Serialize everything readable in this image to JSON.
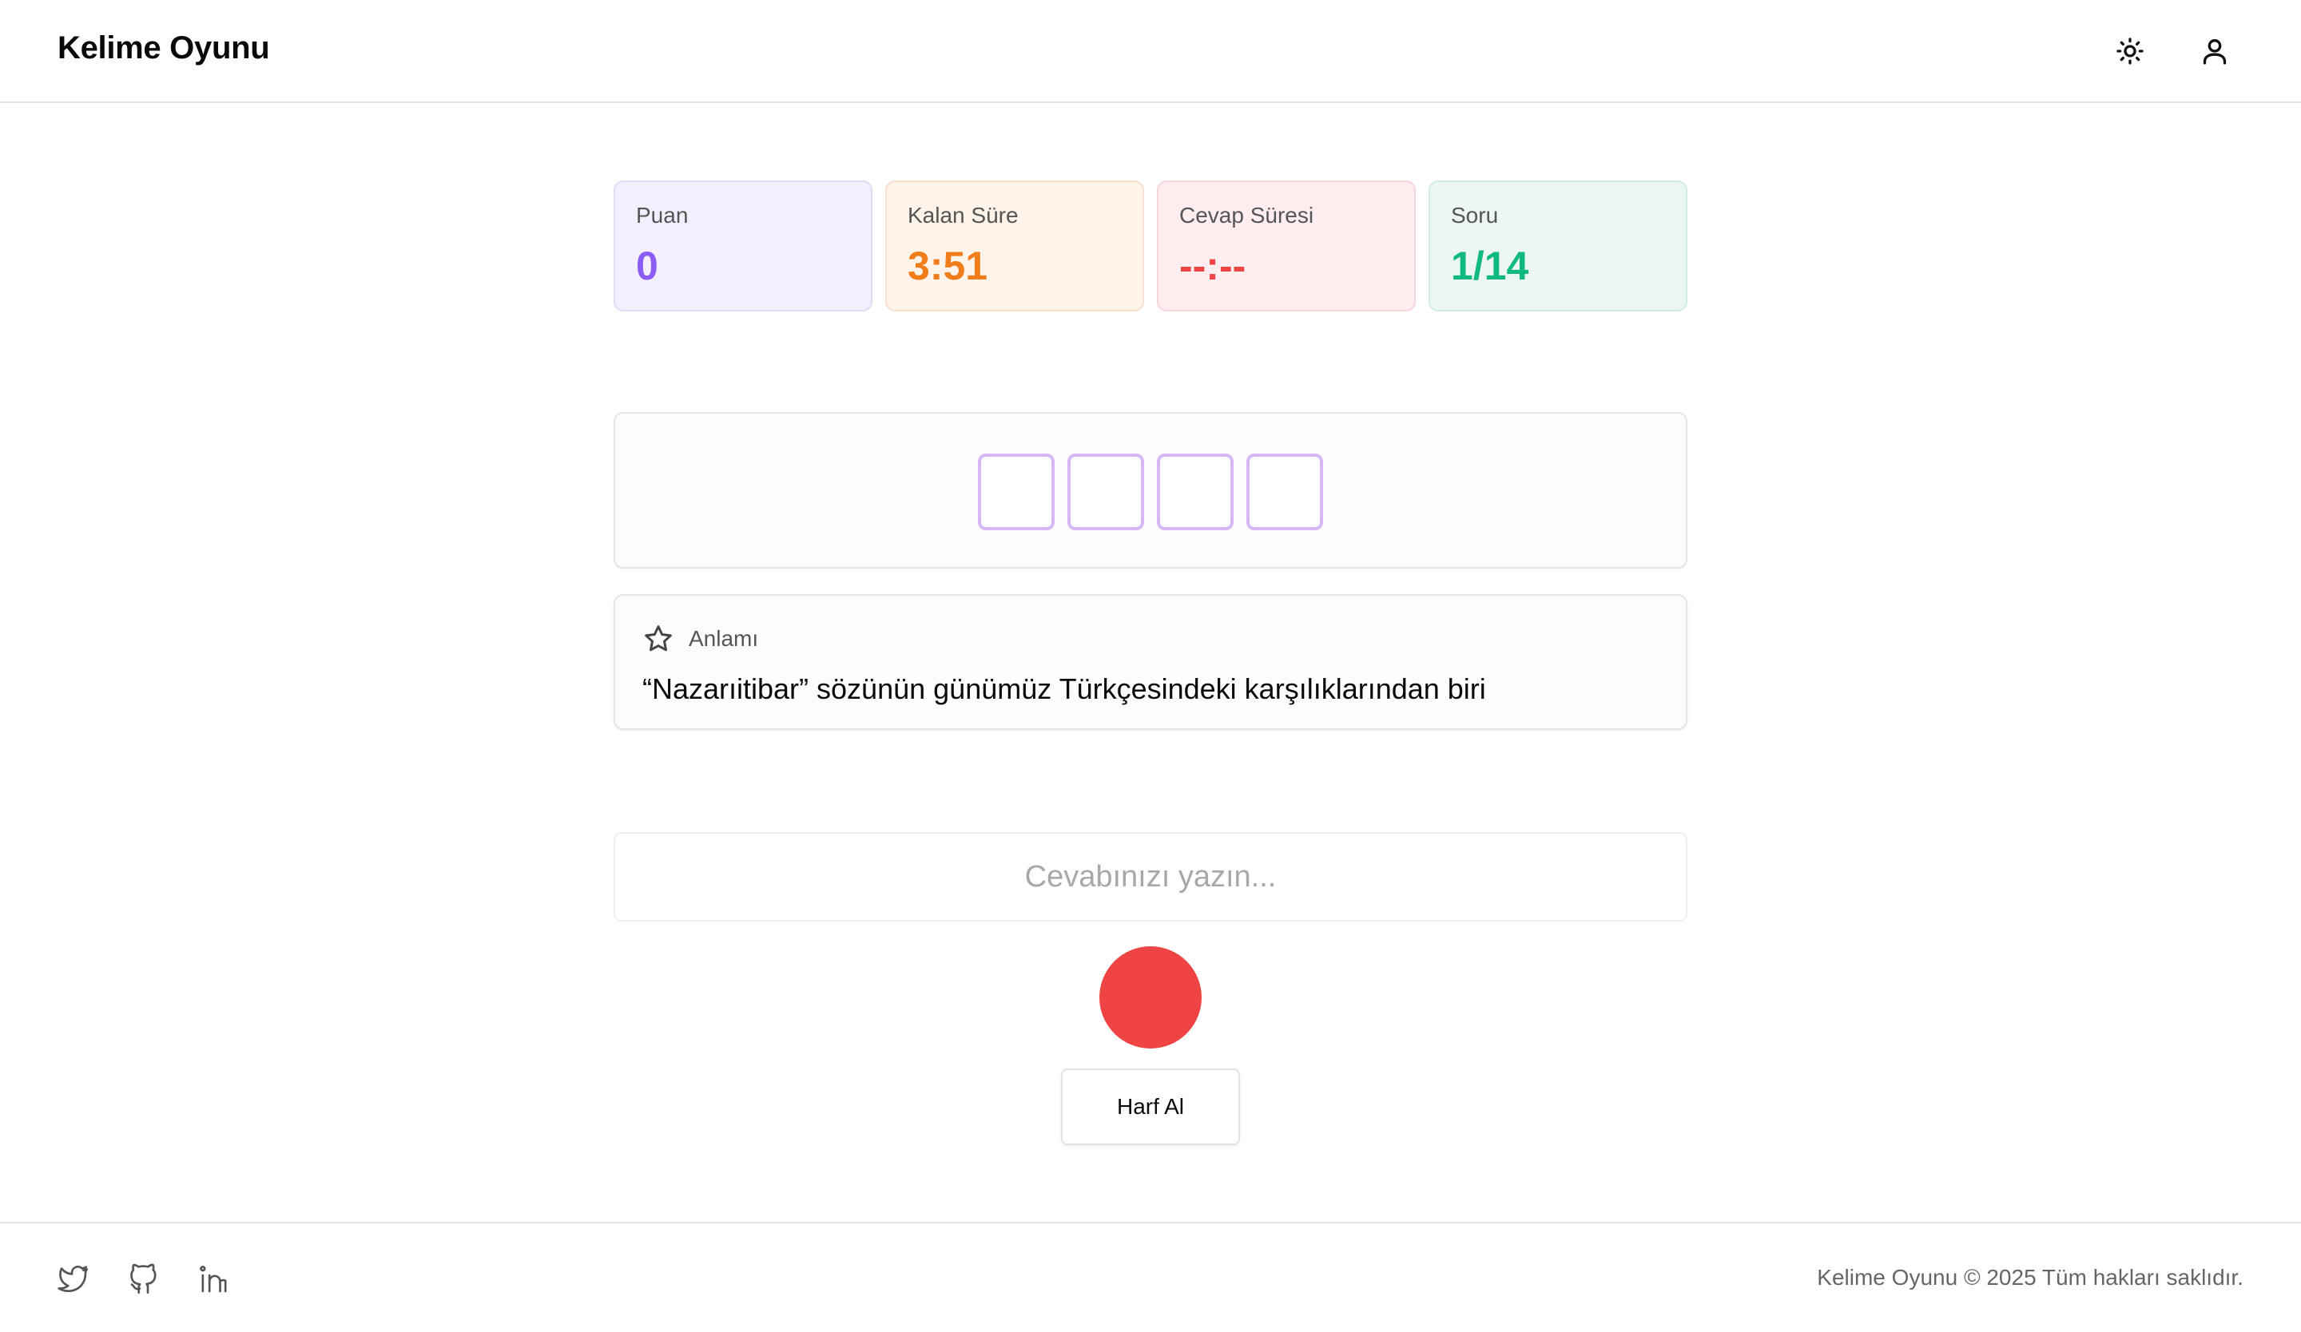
{
  "header": {
    "title": "Kelime Oyunu",
    "theme_icon": "sun-icon",
    "user_icon": "user-icon"
  },
  "stats": {
    "score": {
      "label": "Puan",
      "value": "0",
      "color": "#8b5cf6"
    },
    "time_left": {
      "label": "Kalan Süre",
      "value": "3:51",
      "color": "#f07c1a"
    },
    "answer_time": {
      "label": "Cevap Süresi",
      "value": "--:--",
      "color": "#ef4444"
    },
    "question": {
      "label": "Soru",
      "value": "1/14",
      "color": "#10b981"
    }
  },
  "word": {
    "letters": [
      "",
      "",
      "",
      ""
    ]
  },
  "meaning": {
    "icon": "star-icon",
    "label": "Anlamı",
    "text": "“Nazarıitibar” sözünün günümüz Türkçesindeki karşılıklarından biri"
  },
  "answer": {
    "value": "",
    "placeholder": "Cevabınızı yazın..."
  },
  "controls": {
    "record_color": "#ef4444",
    "hint_label": "Harf Al"
  },
  "footer": {
    "social_icons": [
      "twitter-icon",
      "github-icon",
      "linkedin-icon"
    ],
    "copyright": "Kelime Oyunu © 2025 Tüm hakları saklıdır."
  }
}
